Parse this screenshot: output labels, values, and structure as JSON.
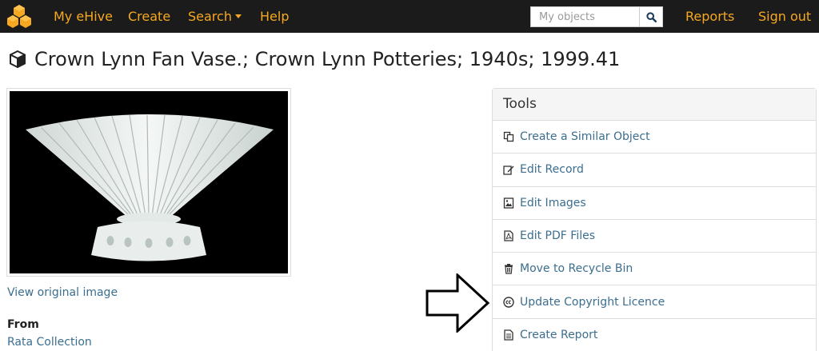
{
  "nav": {
    "my_ehive": "My eHive",
    "create": "Create",
    "search": "Search",
    "help": "Help",
    "search_placeholder": "My objects",
    "reports": "Reports",
    "sign_out": "Sign out"
  },
  "page": {
    "title": "Crown Lynn Fan Vase.; Crown Lynn Potteries; 1940s; 1999.41"
  },
  "image": {
    "view_original": "View original image"
  },
  "details": {
    "from_label": "From",
    "from_value": "Rata Collection"
  },
  "tools": {
    "header": "Tools",
    "items": [
      {
        "label": "Create a Similar Object",
        "icon": "copy-icon"
      },
      {
        "label": "Edit Record",
        "icon": "edit-icon"
      },
      {
        "label": "Edit Images",
        "icon": "image-icon"
      },
      {
        "label": "Edit PDF Files",
        "icon": "pdf-icon"
      },
      {
        "label": "Move to Recycle Bin",
        "icon": "trash-icon"
      },
      {
        "label": "Update Copyright Licence",
        "icon": "creative-commons-icon"
      },
      {
        "label": "Create Report",
        "icon": "report-icon"
      }
    ]
  },
  "colors": {
    "navbar_bg": "#1b1b1b",
    "nav_accent": "#f6a821",
    "link": "#3b6e8f"
  }
}
